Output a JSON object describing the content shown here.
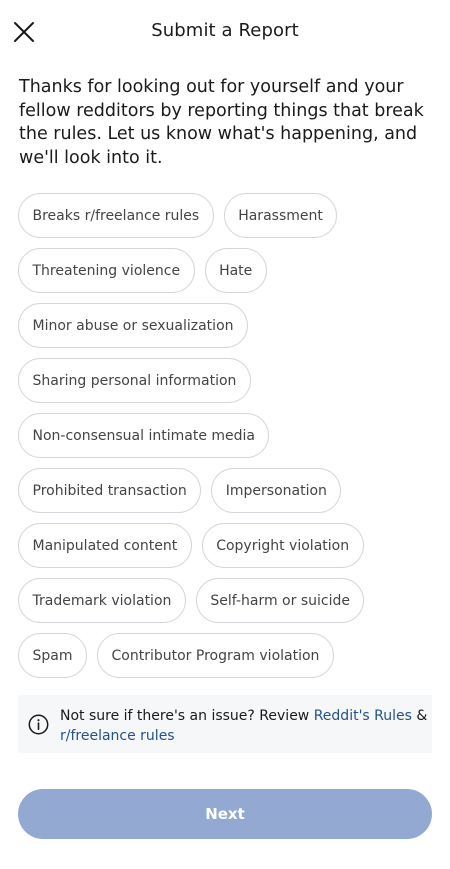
{
  "header": {
    "title": "Submit a Report",
    "close_icon": "close-icon"
  },
  "intro_text": "Thanks for looking out for yourself and your fellow redditors by reporting things that break the rules. Let us know what's happening, and we'll look into it.",
  "report_reasons": [
    "Breaks r/freelance rules",
    "Harassment",
    "Threatening violence",
    "Hate",
    "Minor abuse or sexualization",
    "Sharing personal information",
    "Non-consensual intimate media",
    "Prohibited transaction",
    "Impersonation",
    "Manipulated content",
    "Copyright violation",
    "Trademark violation",
    "Self-harm or suicide",
    "Spam",
    "Contributor Program violation"
  ],
  "info_box": {
    "icon": "info-icon",
    "text_before": "Not sure if there's an issue? Review ",
    "link_reddit_rules": "Reddit's Rules",
    "text_and": " & ",
    "link_sub_rules": "r/freelance rules"
  },
  "footer": {
    "next_label": "Next"
  },
  "colors": {
    "link": "#24528a",
    "next_button_disabled": "#93a9d2",
    "chip_border": "#d3d6da",
    "info_background": "#f6f7f8"
  }
}
